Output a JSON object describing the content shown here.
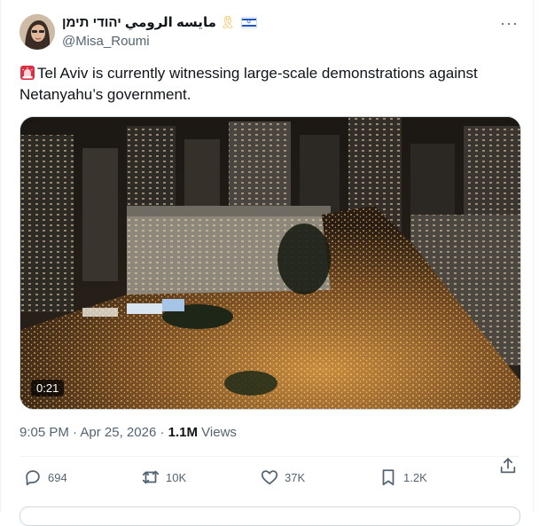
{
  "author": {
    "display_name": "مايسه الرومي יהודי תימן",
    "handle": "@Misa_Roumi",
    "ribbon_icon": "yellow-ribbon-icon",
    "flag_icon": "israel-flag-icon"
  },
  "tweet": {
    "text": "Tel Aviv is currently witnessing large-scale demonstrations against Netanyahu’s government.",
    "emoji_icon": "rotating-light-icon"
  },
  "media": {
    "duration": "0:21"
  },
  "meta": {
    "time": "9:05 PM",
    "date": "Apr 25, 2026",
    "views_count": "1.1M",
    "views_label": "Views"
  },
  "actions": {
    "replies": "694",
    "reposts": "10K",
    "likes": "37K",
    "bookmarks": "1.2K"
  },
  "colors": {
    "text": "#0f1419",
    "secondary": "#536471",
    "border": "#cfd9de"
  }
}
